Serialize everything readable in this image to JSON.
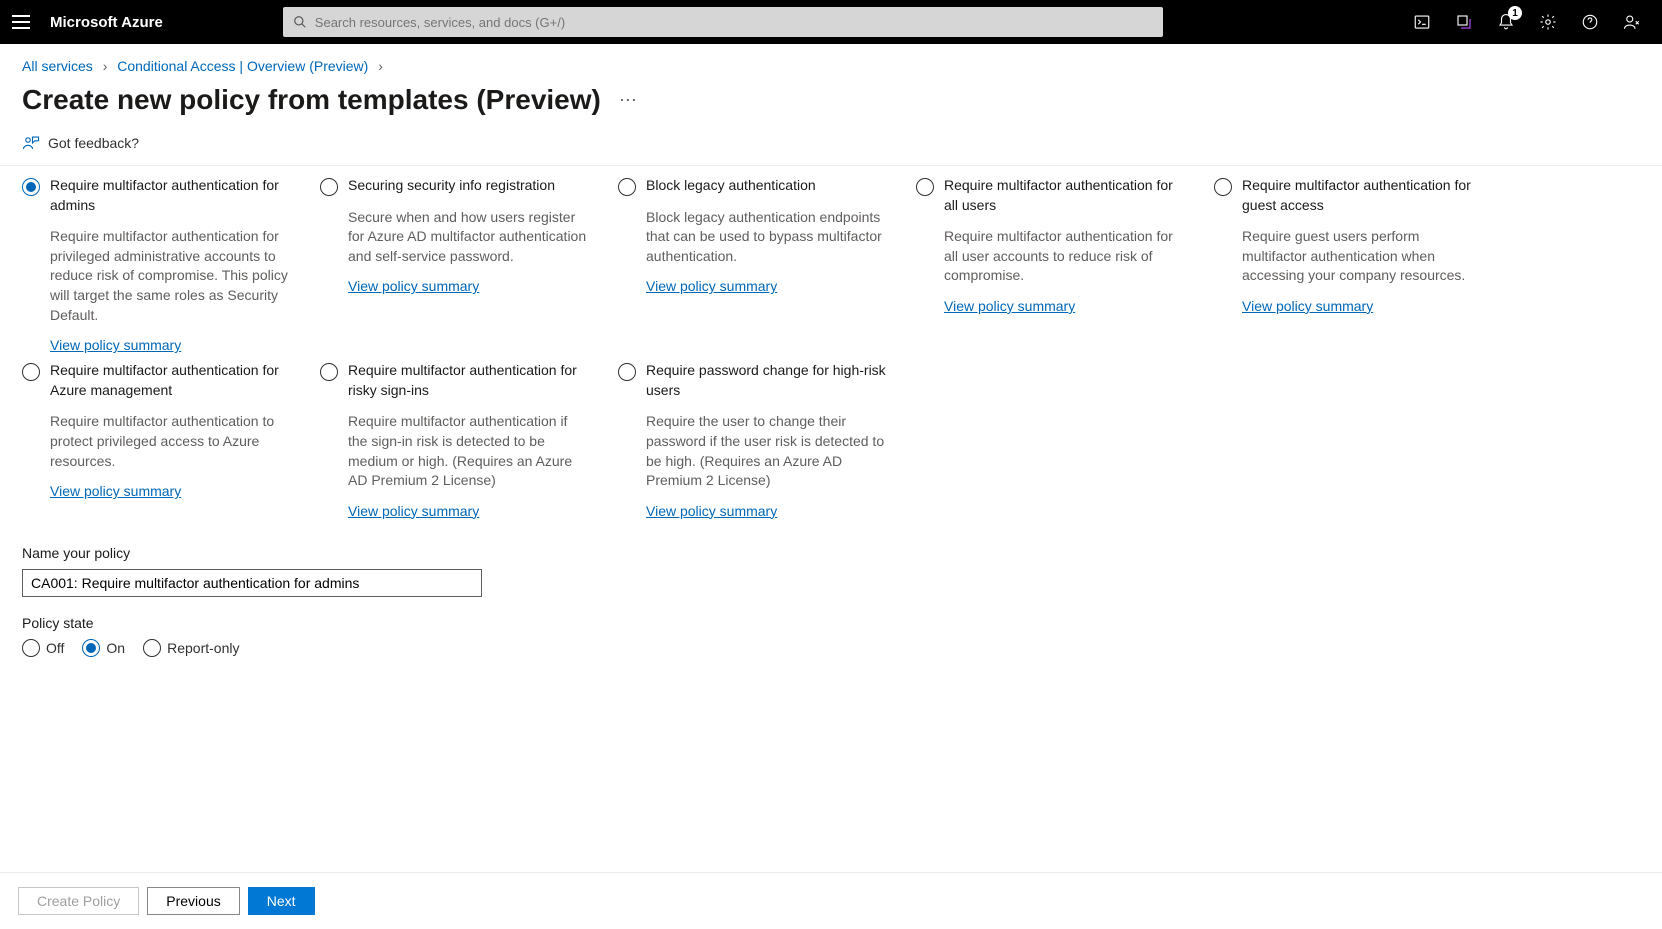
{
  "header": {
    "brand": "Microsoft Azure",
    "search_placeholder": "Search resources, services, and docs (G+/)",
    "notification_count": "1"
  },
  "breadcrumb": {
    "items": [
      "All services",
      "Conditional Access | Overview (Preview)"
    ]
  },
  "page": {
    "title": "Create new policy from templates (Preview)"
  },
  "toolbar": {
    "feedback": "Got feedback?"
  },
  "options": [
    {
      "title": "Require multifactor authentication for admins",
      "desc": "Require multifactor authentication for privileged administrative accounts to reduce risk of compromise. This policy will target the same roles as Security Default.",
      "link": "View policy summary",
      "selected": true
    },
    {
      "title": "Securing security info registration",
      "desc": "Secure when and how users register for Azure AD multifactor authentication and self-service password.",
      "link": "View policy summary",
      "selected": false
    },
    {
      "title": "Block legacy authentication",
      "desc": "Block legacy authentication endpoints that can be used to bypass multifactor authentication.",
      "link": "View policy summary",
      "selected": false
    },
    {
      "title": "Require multifactor authentication for all users",
      "desc": "Require multifactor authentication for all user accounts to reduce risk of compromise.",
      "link": "View policy summary",
      "selected": false
    },
    {
      "title": "Require multifactor authentication for guest access",
      "desc": "Require guest users perform multifactor authentication when accessing your company resources.",
      "link": "View policy summary",
      "selected": false
    },
    {
      "title": "Require multifactor authentication for Azure management",
      "desc": "Require multifactor authentication to protect privileged access to Azure resources.",
      "link": "View policy summary",
      "selected": false
    },
    {
      "title": "Require multifactor authentication for risky sign-ins",
      "desc": "Require multifactor authentication if the sign-in risk is detected to be medium or high. (Requires an Azure AD Premium 2 License)",
      "link": "View policy summary",
      "selected": false
    },
    {
      "title": "Require password change for high-risk users",
      "desc": "Require the user to change their password if the user risk is detected to be high. (Requires an Azure AD Premium 2 License)",
      "link": "View policy summary",
      "selected": false
    }
  ],
  "form": {
    "name_label": "Name your policy",
    "name_value": "CA001: Require multifactor authentication for admins",
    "state_label": "Policy state",
    "states": [
      {
        "label": "Off",
        "selected": false
      },
      {
        "label": "On",
        "selected": true
      },
      {
        "label": "Report-only",
        "selected": false
      }
    ]
  },
  "footer": {
    "create": "Create Policy",
    "previous": "Previous",
    "next": "Next"
  }
}
